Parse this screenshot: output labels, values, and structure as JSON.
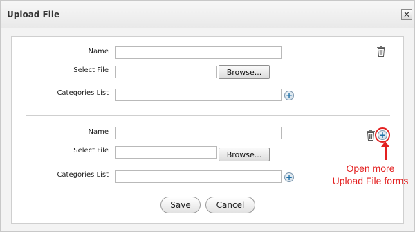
{
  "dialog": {
    "title": "Upload File",
    "close_icon": "close-icon"
  },
  "forms": [
    {
      "name_label": "Name",
      "file_label": "Select File",
      "browse_label": "Browse...",
      "categories_label": "Categories List",
      "name_value": "",
      "file_value": "",
      "categories_value": ""
    },
    {
      "name_label": "Name",
      "file_label": "Select File",
      "browse_label": "Browse...",
      "categories_label": "Categories List",
      "name_value": "",
      "file_value": "",
      "categories_value": ""
    }
  ],
  "buttons": {
    "save": "Save",
    "cancel": "Cancel"
  },
  "annotation": {
    "line1": "Open more",
    "line2": "Upload File forms",
    "color": "#e32020"
  },
  "icons": {
    "delete": "trash-icon",
    "add": "plus-icon"
  }
}
